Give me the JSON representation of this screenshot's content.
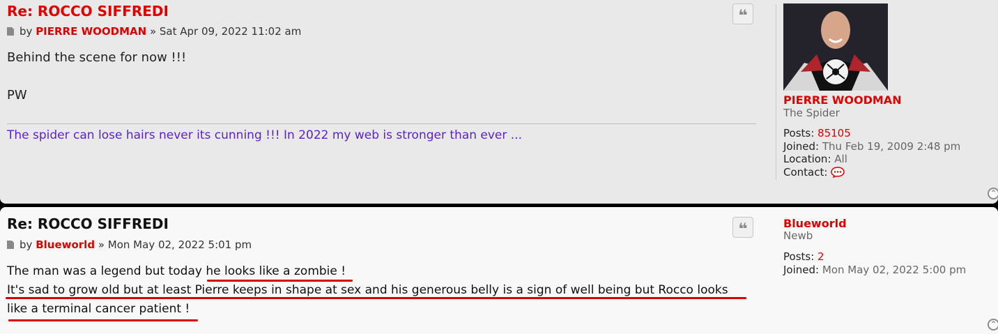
{
  "posts": [
    {
      "title": "Re: ROCCO SIFFREDI",
      "by": "by",
      "author": "PIERRE WOODMAN",
      "date": "» Sat Apr 09, 2022 11:02 am",
      "content": [
        "Behind the scene for now !!!",
        "",
        "PW"
      ],
      "signature": "The spider can lose hairs never its cunning !!! In 2022 my web is stronger than ever ...",
      "profile": {
        "username": "PIERRE WOODMAN",
        "rank": "The Spider",
        "posts_label": "Posts:",
        "posts": "85105",
        "joined_label": "Joined:",
        "joined": "Thu Feb 19, 2009 2:48 pm",
        "location_label": "Location:",
        "location": "All",
        "contact_label": "Contact:"
      }
    },
    {
      "title": "Re: ROCCO SIFFREDI",
      "by": "by",
      "author": "Blueworld",
      "date": "» Mon May 02, 2022 5:01 pm",
      "content": [
        "The man was a legend but today he looks like a zombie !",
        "It's sad to grow old but at least Pierre keeps in shape at sex and his generous belly is a sign of well being but Rocco looks",
        "like a terminal cancer patient !"
      ],
      "profile": {
        "username": "Blueworld",
        "rank": "Newb",
        "posts_label": "Posts:",
        "posts": "2",
        "joined_label": "Joined:",
        "joined": "Mon May 02, 2022 5:00 pm"
      }
    }
  ],
  "icons": {
    "quote": "quote-icon",
    "top": "back-to-top-icon",
    "post": "post-icon",
    "contact": "chat-bubble-icon"
  },
  "colors": {
    "brand_red": "#e00000",
    "signature": "#5b1fd2",
    "annotation": "#d50000"
  }
}
